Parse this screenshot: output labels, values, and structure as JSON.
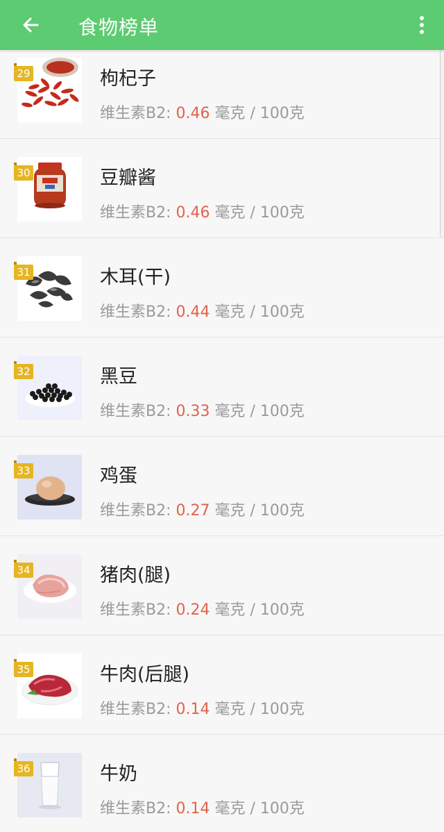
{
  "header": {
    "title": "食物榜单"
  },
  "list": {
    "nutrient_label": "维生素B2:",
    "unit": "毫克 / 100克",
    "items": [
      {
        "rank": "29",
        "name": "枸杞子",
        "value": "0.46",
        "image": "goji-image"
      },
      {
        "rank": "30",
        "name": "豆瓣酱",
        "value": "0.46",
        "image": "bean-paste-image"
      },
      {
        "rank": "31",
        "name": "木耳(干)",
        "value": "0.44",
        "image": "wood-ear-image"
      },
      {
        "rank": "32",
        "name": "黑豆",
        "value": "0.33",
        "image": "black-bean-image"
      },
      {
        "rank": "33",
        "name": "鸡蛋",
        "value": "0.27",
        "image": "egg-image"
      },
      {
        "rank": "34",
        "name": "猪肉(腿)",
        "value": "0.24",
        "image": "pork-image"
      },
      {
        "rank": "35",
        "name": "牛肉(后腿)",
        "value": "0.14",
        "image": "beef-image"
      },
      {
        "rank": "36",
        "name": "牛奶",
        "value": "0.14",
        "image": "milk-image"
      }
    ]
  },
  "colors": {
    "appbar": "#5dcb71",
    "value_red": "#e2634b",
    "rank_badge": "#e5b622"
  }
}
